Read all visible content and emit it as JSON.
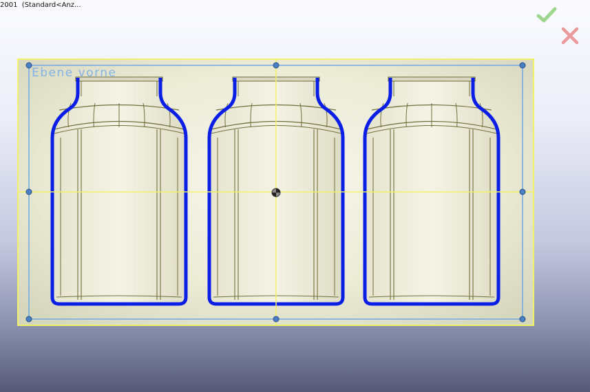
{
  "window": {
    "title": "2001  (Standard<Anz..."
  },
  "confirm": {
    "ok_icon": "checkmark-icon",
    "ok_color": "#8fd07a",
    "cancel_icon": "close-icon",
    "cancel_color": "#e88a8a"
  },
  "plane": {
    "name": "Ebene vorne",
    "color": "#6fa8e6"
  },
  "model": {
    "part_type": "jar",
    "count": 3,
    "outline_color": "#0a1ee6",
    "edge_color": "#6e6e3a",
    "selection_color": "#f2f266"
  }
}
